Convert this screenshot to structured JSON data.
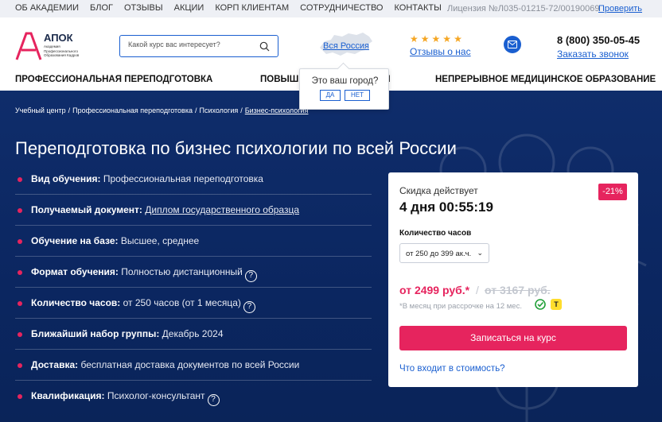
{
  "topnav": [
    "ОБ АКАДЕМИИ",
    "БЛОГ",
    "ОТЗЫВЫ",
    "АКЦИИ",
    "КОРП КЛИЕНТАМ",
    "СОТРУДНИЧЕСТВО",
    "КОНТАКТЫ"
  ],
  "license": "Лицензия №Л035-01215-72/00190069",
  "verify": "Проверить",
  "logo": {
    "name": "АПОК",
    "subtitle": "Академия Профессионального Образования Кадров"
  },
  "search": {
    "placeholder": "Какой курс вас интересует?"
  },
  "region": {
    "label": "Вся Россия"
  },
  "reviews": {
    "stars": 5,
    "link": "Отзывы о нас"
  },
  "contact": {
    "phone": "8 (800) 350-05-45",
    "callback": "Заказать звонок"
  },
  "mainnav": [
    "ПРОФЕССИОНАЛЬНАЯ ПЕРЕПОДГОТОВКА",
    "ПОВЫШ",
    "М",
    "НЕПРЕРЫВНОЕ МЕДИЦИНСКОЕ ОБРАЗОВАНИЕ"
  ],
  "city_popup": {
    "question": "Это ваш город?",
    "yes": "ДА",
    "no": "НЕТ"
  },
  "breadcrumb": [
    "Учебный центр",
    "Профессиональная переподготовка",
    "Психология",
    "Бизнес-психология"
  ],
  "hero_title": "Переподготовка по бизнес психологии по всей России",
  "features": [
    {
      "label": "Вид обучения:",
      "value": " Профессиональная переподготовка"
    },
    {
      "label": "Получаемый документ:",
      "value": "Диплом государственного образца"
    },
    {
      "label": "Обучение на базе:",
      "value": " Высшее, среднее"
    },
    {
      "label": "Формат обучения:",
      "value": " Полностью дистанционный"
    },
    {
      "label": "Количество часов:",
      "value": " от 250 часов (от 1 месяца)"
    },
    {
      "label": "Ближайший набор группы:",
      "value": " Декабрь 2024"
    },
    {
      "label": "Доставка:",
      "value": " бесплатная доставка документов по всей России"
    },
    {
      "label": "Квалификация:",
      "value": " Психолог-консультант"
    }
  ],
  "card": {
    "deal_label": "Скидка действует",
    "timer": "4 дня 00:55:19",
    "discount_badge": "-21%",
    "hours_label": "Количество часов",
    "hours_selected": "от 250 до 399 ак.ч.",
    "price": "от 2499 руб.*",
    "slash": "/",
    "old_price": "от 3167 руб.",
    "installment_note": "*В месяц при рассрочке на 12 мес.",
    "bank_icon_2": "Т",
    "enroll_button": "Записаться на курс",
    "what_included": "Что входит в стоимость?"
  },
  "colors": {
    "accent": "#e6245e",
    "link": "#1a5fd0",
    "hero_bg": "#0f2d6b"
  }
}
